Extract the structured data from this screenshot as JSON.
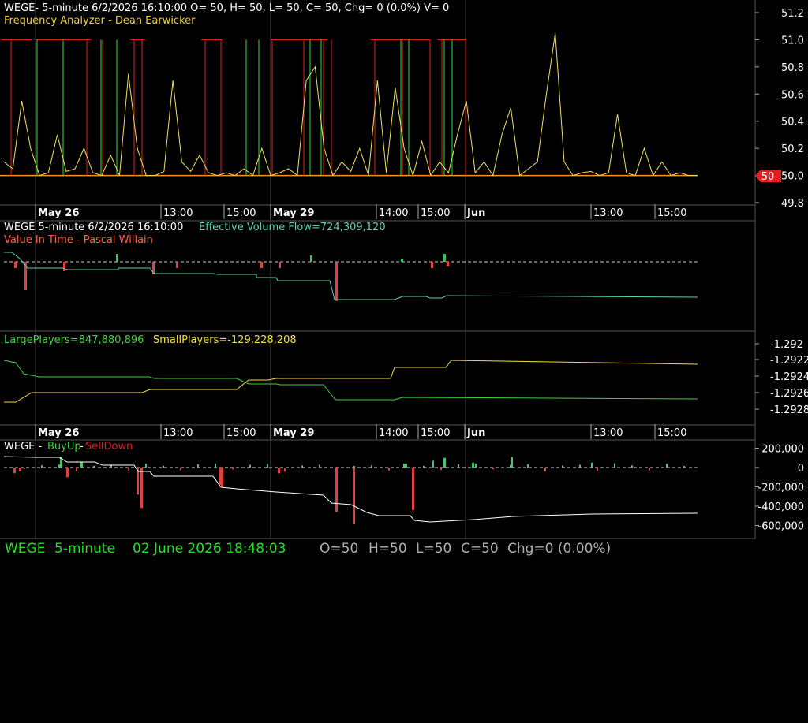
{
  "panels": {
    "price": {
      "header": "WEGE- 5-minute 6/2/2026 16:10:00 O= 50, H= 50, L= 50, C= 50, Chg= 0 (0.0%) V= 0",
      "subheader": "Frequency Analyzer - Dean Earwicker",
      "last_marker": "50",
      "last_price": "50.0"
    },
    "vit": {
      "header": "WEGE 5-minute  6/2/2026 16:10:00",
      "indicator": "Effective Volume Flow=724,309,120",
      "subheader": "Value In Time - Pascal Willain"
    },
    "players": {
      "large": "LargePlayers=847,880,896",
      "small": "SmallPlayers=-129,228,208"
    },
    "buysell": {
      "symbol": "WEGE - ",
      "buy": "BuyUp",
      "sep": "-",
      "sell": "SellDown"
    }
  },
  "status": {
    "symbol": "WEGE",
    "interval": "5-minute",
    "datetime": "02 June 2026 18:48:03",
    "open": "O=50",
    "high": "H=50",
    "low": "L=50",
    "close": "C=50",
    "change": "Chg=0 (0.00%)"
  },
  "colors": {
    "background": "#000000",
    "grid": "#3a3a3a",
    "red_line": "#e02020",
    "green_line": "#30e030",
    "yellow_line": "#f0e060",
    "orange_line": "#ff9020",
    "teal_line": "#60d0b0",
    "status_green": "#20e020",
    "status_gray": "#b0b0b0"
  },
  "chart_data": [
    {
      "type": "line",
      "title": "Frequency Analyzer - Dean Earwicker",
      "y_ticks": [
        "51.2",
        "51.0",
        "50.8",
        "50.6",
        "50.4",
        "50.2",
        "50.0",
        "49.8"
      ],
      "ylim": [
        49.8,
        51.2
      ],
      "x_ticks": [
        "May 26",
        "13:00",
        "15:00",
        "May 29",
        "14:00",
        "15:00",
        "Jun",
        "13:00",
        "15:00"
      ],
      "series": [
        {
          "color": "yellow",
          "values": [
            50.1,
            50.05,
            50.55,
            50.2,
            50.0,
            50.02,
            50.3,
            50.03,
            50.05,
            50.2,
            50.02,
            50.0,
            50.15,
            50.0,
            50.75,
            50.2,
            50.0,
            50.0,
            50.03,
            50.7,
            50.1,
            50.03,
            50.15,
            50.02,
            50.0,
            50.02,
            50.0,
            50.05,
            50.0,
            50.2,
            50.0,
            50.02,
            50.05,
            50.0,
            50.7,
            50.8,
            50.2,
            50.0,
            50.1,
            50.03,
            50.2,
            50.0,
            50.7,
            50.02,
            50.65,
            50.2,
            50.0,
            50.25,
            50.0,
            50.1,
            50.02,
            50.3,
            50.55,
            50.02,
            50.1,
            50.0,
            50.3,
            50.5,
            50.0,
            50.05,
            50.1,
            50.6,
            51.05,
            50.1,
            50.0,
            50.02,
            50.03,
            50.0,
            50.02,
            50.45,
            50.02,
            50.0,
            50.2,
            50.0,
            50.1,
            50.0,
            50.02,
            50.0,
            50.0
          ]
        },
        {
          "color": "orange",
          "values": [
            50.0,
            50.0
          ]
        }
      ],
      "annotations": [
        "50"
      ]
    },
    {
      "type": "line",
      "title": "Value In Time - Pascal Willain",
      "series": [
        {
          "name": "Effective Volume Flow",
          "values": [
            724309120
          ]
        }
      ]
    },
    {
      "type": "line",
      "y_ticks": [
        "-1.292",
        "-1.2922",
        "-1.2924",
        "-1.2926",
        "-1.2928"
      ],
      "series": [
        {
          "name": "LargePlayers",
          "values": [
            847880896
          ]
        },
        {
          "name": "SmallPlayers",
          "values": [
            -129228208
          ]
        }
      ],
      "x_ticks": [
        "May 26",
        "13:00",
        "15:00",
        "May 29",
        "14:00",
        "15:00",
        "Jun",
        "13:00",
        "15:00"
      ]
    },
    {
      "type": "bar",
      "title": "WEGE - BuyUp-SellDown",
      "y_ticks": [
        "200,000",
        "0",
        "-200,000",
        "-400,000",
        "-600,000"
      ],
      "ylim": [
        -700000,
        260000
      ]
    }
  ]
}
